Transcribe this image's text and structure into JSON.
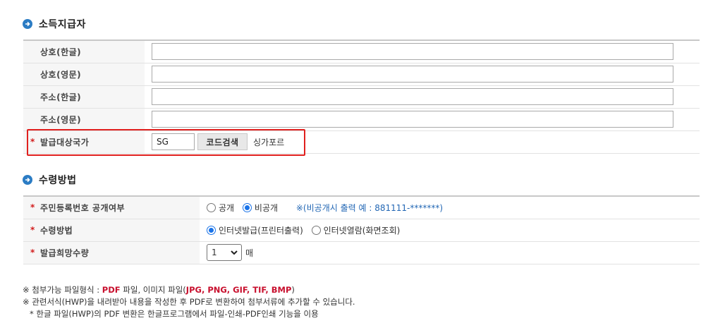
{
  "sections": {
    "income_payer": {
      "title": "소득지급자"
    },
    "receipt_method": {
      "title": "수령방법"
    }
  },
  "income_payer": {
    "fields": [
      {
        "label": "상호(한글)",
        "value": ""
      },
      {
        "label": "상호(영문)",
        "value": ""
      },
      {
        "label": "주소(한글)",
        "value": ""
      },
      {
        "label": "주소(영문)",
        "value": ""
      }
    ],
    "country": {
      "required_mark": "*",
      "label": "발급대상국가",
      "code_value": "SG",
      "search_button": "코드검색",
      "country_name": "싱가포르"
    }
  },
  "receipt": {
    "resident_no": {
      "required_mark": "*",
      "label": "주민등록번호 공개여부",
      "options": [
        {
          "label": "공개",
          "checked": false
        },
        {
          "label": "비공개",
          "checked": true
        }
      ],
      "note": "※(비공개시 출력 예 : 881111-*******)"
    },
    "method": {
      "required_mark": "*",
      "label": "수령방법",
      "options": [
        {
          "label": "인터넷발급(프린터출력)",
          "checked": true
        },
        {
          "label": "인터넷열람(화면조회)",
          "checked": false
        }
      ]
    },
    "quantity": {
      "required_mark": "*",
      "label": "발급희망수량",
      "value": "1",
      "unit": "매"
    }
  },
  "notes": {
    "line1_prefix": "※ 첨부가능 파일형식 : ",
    "line1_pdf": "PDF",
    "line1_mid": " 파일, 이미지 파일(",
    "line1_images": "JPG, PNG, GIF, TIF, BMP",
    "line1_suffix": ")",
    "line2": "※ 관련서식(HWP)을 내려받아 내용을 작성한 후 PDF로 변환하여 첨부서류에 추가할 수 있습니다.",
    "line3": "* 한글 파일(HWP)의 PDF 변환은 한글프로그램에서 파일-인쇄-PDF인쇄 기능을 이용"
  },
  "colors": {
    "accent_blue": "#2b7cc4",
    "highlight_red": "#e0201e",
    "required_red": "#d21c1c",
    "note_blue": "#2468b5"
  },
  "icons": {
    "section_bullet": "arrow-circle-right-icon",
    "select_arrow": "chevron-down-icon"
  }
}
